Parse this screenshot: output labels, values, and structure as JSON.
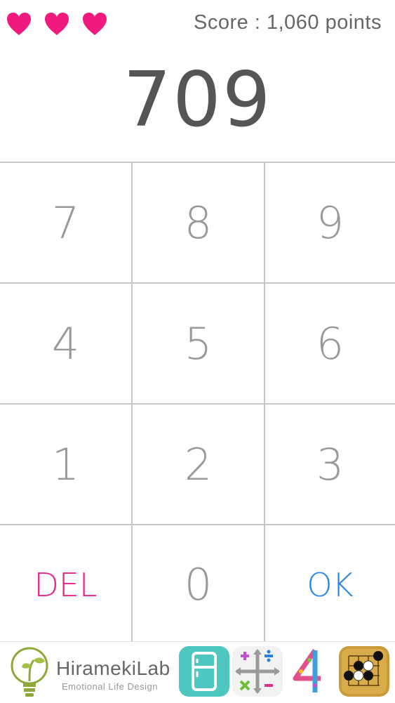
{
  "header": {
    "lives": [
      "heart-icon",
      "heart-icon",
      "heart-icon"
    ],
    "score_text": "Score : 1,060 points"
  },
  "display": {
    "value": "709"
  },
  "keypad": {
    "rows": [
      [
        "7",
        "8",
        "9"
      ],
      [
        "4",
        "5",
        "6"
      ],
      [
        "1",
        "2",
        "3"
      ],
      [
        "DEL",
        "0",
        "OK"
      ]
    ]
  },
  "ad": {
    "brand_name": "HiramekiLab",
    "tagline": "Emotional Life Design",
    "apps": [
      "fridge-app-icon",
      "math-operators-app-icon",
      "number-four-app-icon",
      "go-game-app-icon"
    ]
  },
  "colors": {
    "heart": "#f0197d",
    "del": "#e8248a",
    "ok": "#2a86e0",
    "digits": "#999999",
    "display": "#555555"
  }
}
